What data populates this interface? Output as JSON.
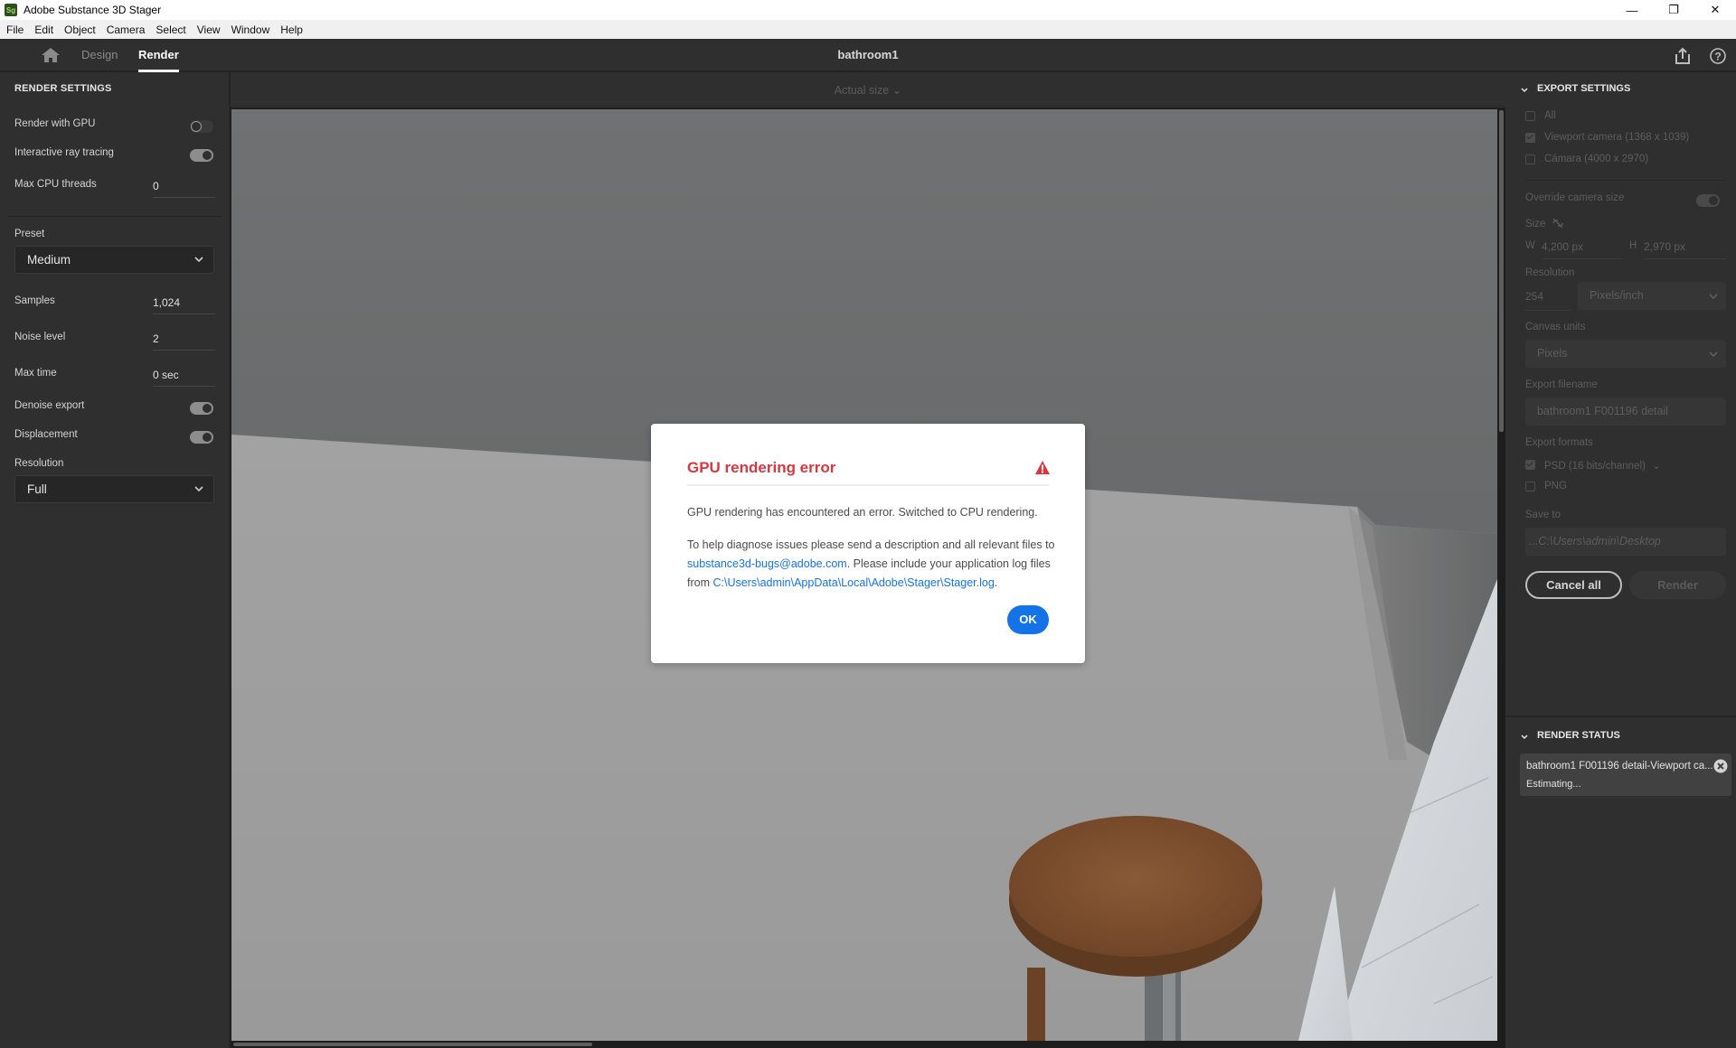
{
  "window": {
    "title": "Adobe Substance 3D Stager",
    "app_icon_label": "Sg",
    "controls": {
      "minimize": "—",
      "restore": "❐",
      "close": "✕"
    }
  },
  "menubar": {
    "items": [
      "File",
      "Edit",
      "Object",
      "Camera",
      "Select",
      "View",
      "Window",
      "Help"
    ]
  },
  "header": {
    "tabs": [
      {
        "label": "Design",
        "active": false
      },
      {
        "label": "Render",
        "active": true
      }
    ],
    "document_title": "bathroom1"
  },
  "render_settings": {
    "title": "RENDER SETTINGS",
    "render_with_gpu": {
      "label": "Render with GPU",
      "on": false
    },
    "interactive_ray_tracing": {
      "label": "Interactive ray tracing",
      "on": true
    },
    "max_cpu_threads": {
      "label": "Max CPU threads",
      "value": "0"
    },
    "preset": {
      "label": "Preset",
      "value": "Medium"
    },
    "samples": {
      "label": "Samples",
      "value": "1,024"
    },
    "noise_level": {
      "label": "Noise level",
      "value": "2"
    },
    "max_time": {
      "label": "Max time",
      "value": "0 sec"
    },
    "denoise_export": {
      "label": "Denoise export",
      "on": true
    },
    "displacement": {
      "label": "Displacement",
      "on": true
    },
    "resolution": {
      "label": "Resolution",
      "value": "Full"
    }
  },
  "viewport": {
    "zoom_label": "Actual size"
  },
  "export_settings": {
    "title": "EXPORT SETTINGS",
    "cameras": [
      {
        "label": "All",
        "checked": false
      },
      {
        "label": "Viewport camera (1368 x 1039)",
        "checked": true
      },
      {
        "label": "Cámara (4000 x 2970)",
        "checked": false
      }
    ],
    "override_camera_size": {
      "label": "Override camera size",
      "on": true
    },
    "size_label": "Size",
    "width": {
      "prefix": "W",
      "value": "4,200 px"
    },
    "height": {
      "prefix": "H",
      "value": "2,970 px"
    },
    "resolution": {
      "label": "Resolution",
      "value": "254",
      "unit": "Pixels/inch"
    },
    "canvas_units": {
      "label": "Canvas units",
      "value": "Pixels"
    },
    "export_filename": {
      "label": "Export filename",
      "value": "bathroom1 F001196 detail"
    },
    "export_formats": {
      "label": "Export formats",
      "items": [
        {
          "label": "PSD (16 bits/channel)",
          "checked": true
        },
        {
          "label": "PNG",
          "checked": false
        }
      ]
    },
    "save_to": {
      "label": "Save to",
      "value": "...C:\\Users\\admin\\Desktop"
    },
    "cancel_all_label": "Cancel all",
    "render_label": "Render"
  },
  "render_status": {
    "title": "RENDER STATUS",
    "job_name": "bathroom1 F001196 detail-Viewport ca...",
    "job_status": "Estimating..."
  },
  "dialog": {
    "title": "GPU rendering error",
    "message1": "GPU rendering has encountered an error. Switched to CPU rendering.",
    "message2_pre": "To help diagnose issues please send a description and all relevant files to ",
    "email_link": "substance3d-bugs@adobe.com",
    "message2_mid": ". Please include your application log files from ",
    "log_path_link": "C:\\Users\\admin\\AppData\\Local\\Adobe\\Stager\\Stager.log",
    "message2_post": ".",
    "ok_label": "OK",
    "colors": {
      "title": "#d7373f",
      "link": "#1473e6",
      "button": "#1473e6"
    }
  }
}
